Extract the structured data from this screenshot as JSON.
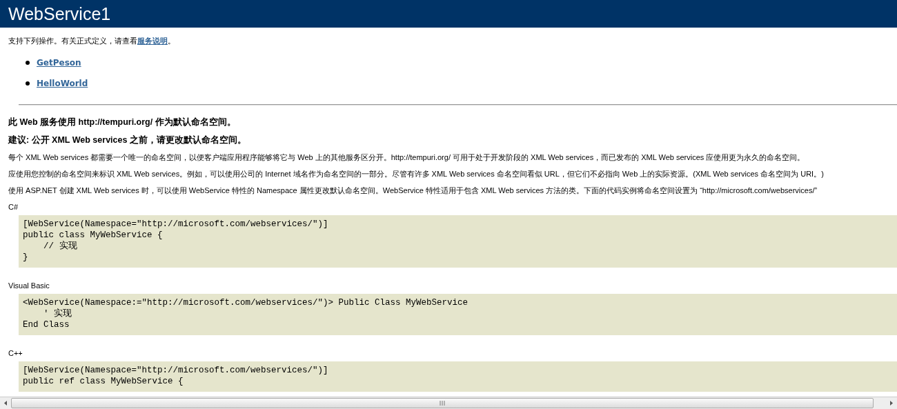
{
  "header": {
    "title": "WebService1"
  },
  "intro": {
    "text": "支持下列操作。有关正式定义，请查看",
    "link": "服务说明",
    "end": "。"
  },
  "operations": [
    {
      "label": "GetPeson"
    },
    {
      "label": "HelloWorld"
    }
  ],
  "headings": [
    "此  Web 服务使用  http://tempuri.org/ 作为默认命名空间。",
    "建议: 公开  XML Web services 之前，请更改默认命名空间。"
  ],
  "paragraphs": [
    "每个  XML Web services 都需要一个唯一的命名空间，以便客户端应用程序能够将它与  Web 上的其他服务区分开。http://tempuri.org/ 可用于处于开发阶段的  XML Web services，而已发布的  XML Web services 应使用更为永久的命名空间。",
    "应使用您控制的命名空间来标识  XML Web services。例如，可以使用公司的  Internet 域名作为命名空间的一部分。尽管有许多  XML Web services 命名空间看似  URL，但它们不必指向  Web 上的实际资源。(XML Web services 命名空间为  URI。)",
    "使用  ASP.NET 创建  XML Web services 时，可以使用  WebService 特性的  Namespace 属性更改默认命名空间。WebService 特性适用于包含  XML Web services 方法的类。下面的代码实例将命名空间设置为 “http://microsoft.com/webservices/”"
  ],
  "samples": [
    {
      "language": "C#",
      "lines": [
        "[WebService(Namespace=\"http://microsoft.com/webservices/\")]",
        "public class MyWebService {",
        "    // 实现",
        "}"
      ]
    },
    {
      "language": "Visual Basic",
      "lines": [
        "<WebService(Namespace:=\"http://microsoft.com/webservices/\")> Public Class MyWebService",
        "    ' 实现",
        "End Class"
      ]
    },
    {
      "language": "C++",
      "lines": [
        "[WebService(Namespace=\"http://microsoft.com/webservices/\")]",
        "public ref class MyWebService {"
      ]
    }
  ]
}
